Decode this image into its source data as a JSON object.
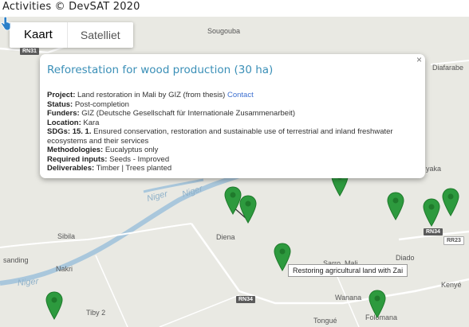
{
  "page_title": "Activities © DevSAT 2020",
  "map_type": {
    "map_label": "Kaart",
    "satellite_label": "Satelliet",
    "selected": "Kaart"
  },
  "places": {
    "sougouba": "Sougouba",
    "diafarabe": "Diafarabe",
    "yaka": "yaka",
    "sibila": "Sibila",
    "sanding": "sanding",
    "nakri": "Nakri",
    "diena": "Diena",
    "sarro_mali": "Sarro, Mali",
    "diado": "Diado",
    "kenye": "Kenyé",
    "wanana": "Wanana",
    "tiby": "Tiby 2",
    "folomana": "Folomana",
    "tongue": "Tongué"
  },
  "rivers": {
    "niger_1": "Niger",
    "niger_2": "Niger",
    "niger_3": "Niger"
  },
  "roads": {
    "rn31": "RN31",
    "rn34_a": "RN34",
    "rn34_b": "RN34",
    "rn23": "RR23"
  },
  "popup": {
    "title": "Reforestation for wood production (30 ha)",
    "close": "×",
    "project_label": "Project:",
    "project_value": "Land restoration in Mali by GIZ (from thesis)",
    "project_link": "Contact",
    "status_label": "Status:",
    "status_value": "Post-completion",
    "funders_label": "Funders:",
    "funders_value": "GIZ (Deutsche Gesellschaft für Internationale Zusammenarbeit)",
    "location_label": "Location:",
    "location_value": "Kara",
    "sdgs_label": "SDGs:",
    "sdgs_number": "15. 1.",
    "sdgs_value": "Ensured conservation, restoration and sustainable use of terrestrial and inland freshwater ecosystems and their services",
    "methodologies_label": "Methodologies:",
    "methodologies_value": "Eucalyptus only",
    "inputs_label": "Required inputs:",
    "inputs_value": "Seeds - Improved",
    "deliverables_label": "Deliverables:",
    "deliverables_value": "Timber | Trees planted"
  },
  "tooltip": "Restoring agricultural land with Zai",
  "colors": {
    "pin": "#2d9a3e",
    "pin_dark": "#1f7a2c",
    "popup_title": "#3a8fb7",
    "river": "#a9c7dc"
  }
}
